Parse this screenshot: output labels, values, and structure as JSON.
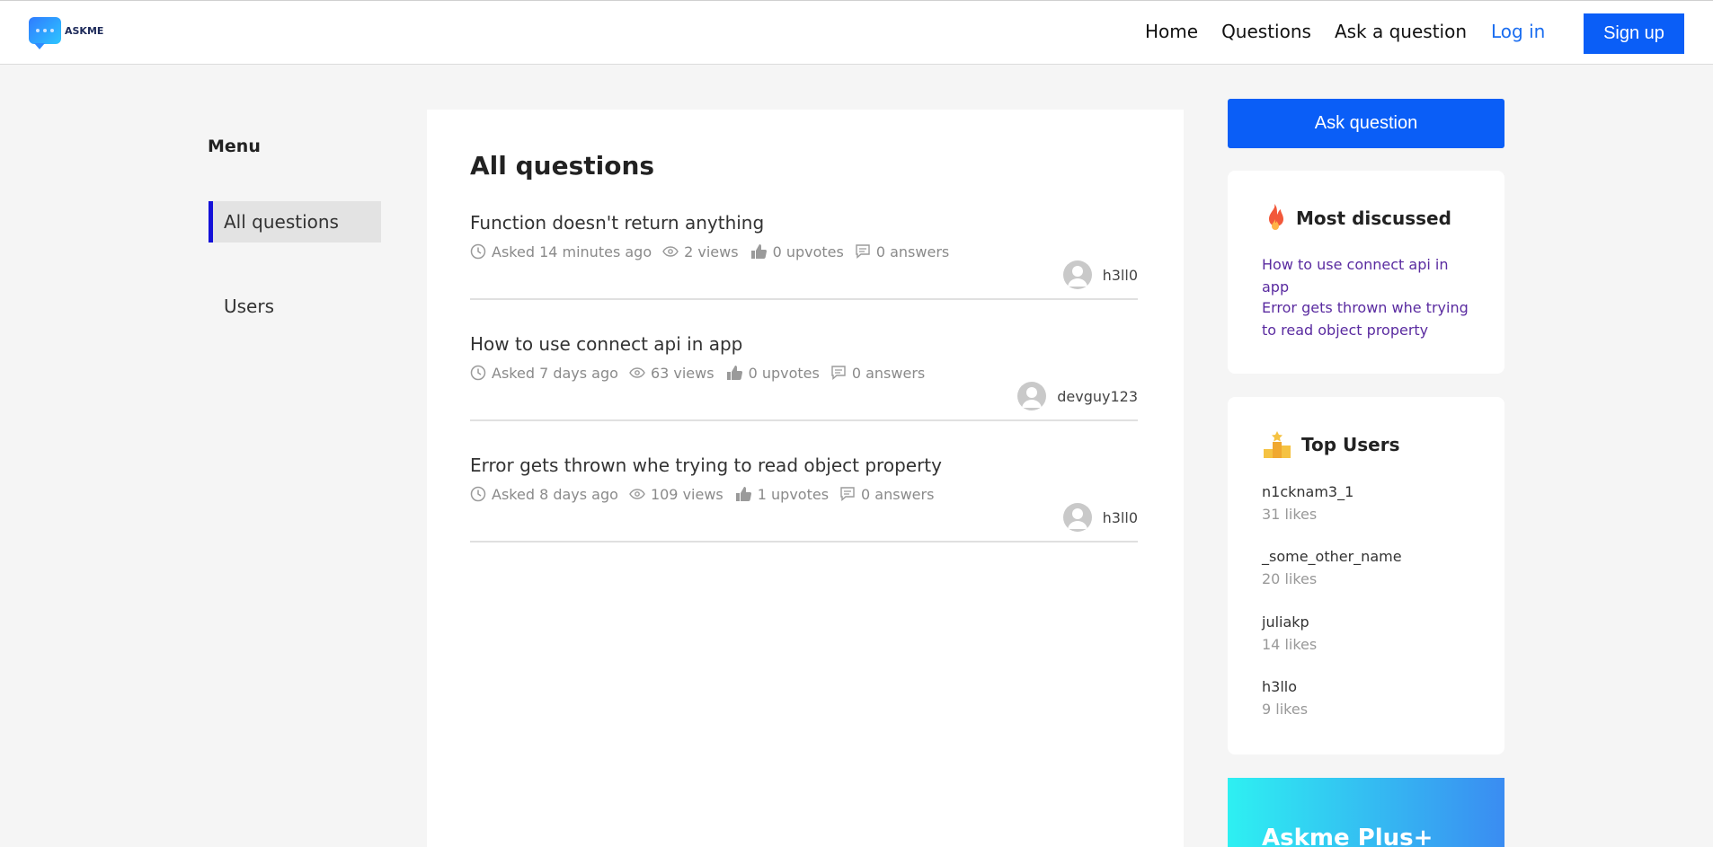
{
  "brand": {
    "name": "ASKME"
  },
  "nav": {
    "home": "Home",
    "questions": "Questions",
    "ask": "Ask a question",
    "login": "Log in",
    "signup": "Sign up"
  },
  "sidebar": {
    "title": "Menu",
    "items": [
      {
        "label": "All questions",
        "active": true
      },
      {
        "label": "Users",
        "active": false
      }
    ]
  },
  "main": {
    "title": "All questions",
    "questions": [
      {
        "title": "Function doesn't return anything",
        "asked": "Asked 14 minutes ago",
        "views": "2 views",
        "upvotes": "0 upvotes",
        "answers": "0 answers",
        "author": "h3ll0"
      },
      {
        "title": "How to use connect api in app",
        "asked": "Asked 7 days ago",
        "views": "63 views",
        "upvotes": "0 upvotes",
        "answers": "0 answers",
        "author": "devguy123"
      },
      {
        "title": "Error gets thrown whe trying to read object property",
        "asked": "Asked 8 days ago",
        "views": "109 views",
        "upvotes": "1 upvotes",
        "answers": "0 answers",
        "author": "h3ll0"
      }
    ]
  },
  "right": {
    "ask_button": "Ask question",
    "most_discussed": {
      "title": "Most discussed",
      "items": [
        "How to use connect api in app",
        "Error gets thrown whe trying to read object property"
      ]
    },
    "top_users": {
      "title": "Top Users",
      "users": [
        {
          "name": "n1cknam3_1",
          "likes": "31 likes"
        },
        {
          "name": "_some_other_name",
          "likes": "20 likes"
        },
        {
          "name": "juliakp",
          "likes": "14 likes"
        },
        {
          "name": "h3llo",
          "likes": "9 likes"
        }
      ]
    },
    "promo": {
      "title": "Askme Plus+"
    }
  },
  "colors": {
    "primary": "#0a5ef7",
    "link": "#1a6df0",
    "accent_bar": "#1411d8",
    "discussed_link": "#5a2ba0"
  },
  "icons": [
    "clock-icon",
    "eye-icon",
    "thumbs-up-icon",
    "comment-icon",
    "fire-icon",
    "podium-icon",
    "avatar-icon"
  ]
}
